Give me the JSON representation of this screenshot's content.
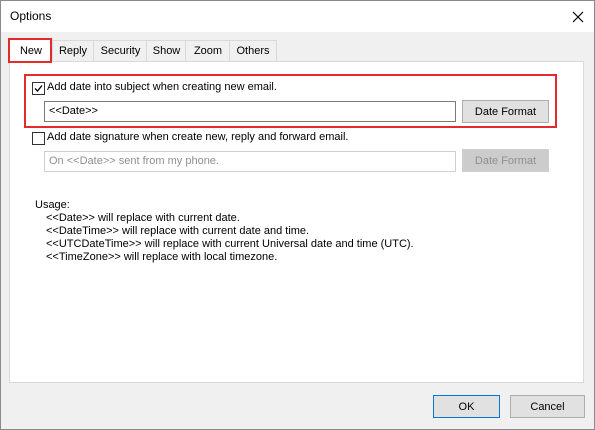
{
  "window": {
    "title": "Options",
    "close_icon": "close-icon"
  },
  "tabs": [
    {
      "label": "New",
      "active": true
    },
    {
      "label": "Reply",
      "active": false
    },
    {
      "label": "Security",
      "active": false
    },
    {
      "label": "Show",
      "active": false
    },
    {
      "label": "Zoom",
      "active": false
    },
    {
      "label": "Others",
      "active": false
    }
  ],
  "subject_option": {
    "checked": true,
    "label": "Add date into subject when creating new email.",
    "field_value": "<<Date>>",
    "button_label": "Date Format"
  },
  "signature_option": {
    "checked": false,
    "label": "Add date signature when create new, reply and forward email.",
    "field_placeholder": "On <<Date>> sent from my phone.",
    "button_label": "Date Format"
  },
  "usage": {
    "heading": "Usage:",
    "lines": [
      "<<Date>> will replace with current date.",
      "<<DateTime>> will replace with current date and time.",
      "<<UTCDateTime>> will replace with current Universal date and time (UTC).",
      "<<TimeZone>> will replace with local timezone."
    ]
  },
  "footer": {
    "ok_label": "OK",
    "cancel_label": "Cancel"
  },
  "colors": {
    "highlight": "#e32b2b",
    "focus_border": "#0078d7"
  }
}
